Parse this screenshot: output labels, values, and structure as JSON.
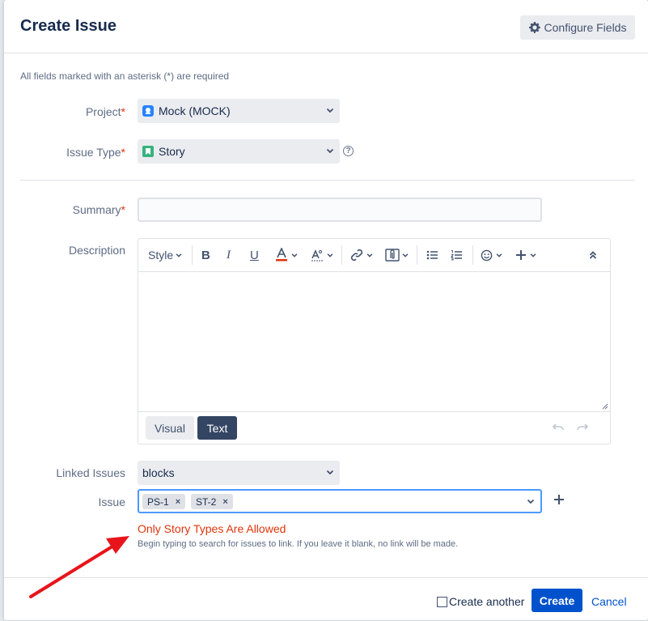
{
  "dialog": {
    "title": "Create Issue",
    "configure_fields_label": "Configure Fields",
    "required_note": "All fields marked with an asterisk (*) are required"
  },
  "fields": {
    "project": {
      "label": "Project",
      "value": "Mock (MOCK)"
    },
    "issue_type": {
      "label": "Issue Type",
      "value": "Story"
    },
    "summary": {
      "label": "Summary",
      "value": ""
    },
    "description": {
      "label": "Description"
    },
    "linked_issues": {
      "label": "Linked Issues",
      "value": "blocks"
    },
    "issue": {
      "label": "Issue",
      "chips": [
        {
          "label": "PS-1"
        },
        {
          "label": "ST-2"
        }
      ],
      "error": "Only Story Types Are Allowed",
      "hint": "Begin typing to search for issues to link. If you leave it blank, no link will be made."
    }
  },
  "editor": {
    "style_label": "Style",
    "modes": [
      {
        "label": "Visual",
        "active": false
      },
      {
        "label": "Text",
        "active": true
      }
    ]
  },
  "footer": {
    "create_another_label": "Create another",
    "create_another_checked": false,
    "create_label": "Create",
    "cancel_label": "Cancel"
  },
  "colors": {
    "primary": "#0052cc",
    "error": "#de350b",
    "annotation_arrow": "#e8141b",
    "active_tab": "#344563"
  },
  "icons": [
    "gear-icon",
    "project-avatar-icon",
    "story-icon",
    "help-icon",
    "chevron-down-icon",
    "bold-icon",
    "italic-icon",
    "underline-icon",
    "text-color-icon",
    "text-format-icon",
    "link-icon",
    "attachment-icon",
    "bullet-list-icon",
    "numbered-list-icon",
    "emoji-icon",
    "add-icon",
    "collapse-icon",
    "undo-icon",
    "redo-icon",
    "remove-icon",
    "plus-icon"
  ]
}
